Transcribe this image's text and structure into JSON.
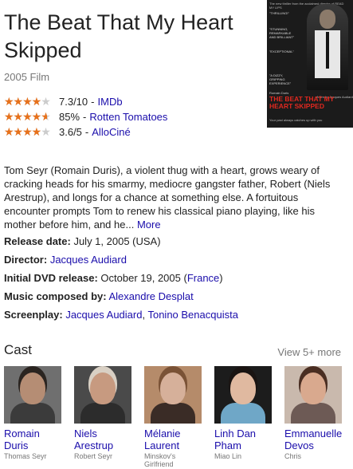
{
  "movie": {
    "title": "The Beat That My Heart Skipped",
    "subtitle": "2005 Film"
  },
  "poster": {
    "header": "The new thriller from the acclaimed director of READ MY LIPS",
    "quotes": [
      "\"THRILLING!\"",
      "\"STUNNING, REMARKABLE AND BRILLIANT\"",
      "\"EXCEPTIONAL\"",
      "\"A DIZZY, GRIPPING EXPERIENCE\""
    ],
    "director_name": "Romain Duris",
    "credit": "A film by Jacques Audiard",
    "title": "THE BEAT THAT MY HEART SKIPPED",
    "tagline": "Your past always catches up with you"
  },
  "ratings": [
    {
      "score": "7.3/10",
      "source": "IMDb",
      "stars_fraction": 0.73
    },
    {
      "score": "85%",
      "source": "Rotten Tomatoes",
      "stars_fraction": 0.85
    },
    {
      "score": "3.6/5",
      "source": "AlloCiné",
      "stars_fraction": 0.72
    }
  ],
  "rating_separator": "-",
  "description": {
    "text": "Tom Seyr (Romain Duris), a violent thug with a heart, grows weary of cracking heads for his smarmy, mediocre gangster father, Robert (Niels Arestrup), and longs for a chance at something else. A fortuitous encounter prompts Tom to renew his classical piano playing, like his mother before him, and he...",
    "more_label": "More"
  },
  "facts": {
    "release": {
      "label": "Release date:",
      "value": "July 1, 2005 (USA)"
    },
    "director": {
      "label": "Director:",
      "value": "Jacques Audiard"
    },
    "dvd": {
      "label": "Initial DVD release:",
      "value": "October 19, 2005 (",
      "link": "France",
      "after": ")"
    },
    "music": {
      "label": "Music composed by:",
      "value": "Alexandre Desplat"
    },
    "screenplay": {
      "label": "Screenplay:",
      "value1": "Jacques Audiard",
      "comma": ",",
      "value2": "Tonino Benacquista"
    }
  },
  "cast": {
    "title": "Cast",
    "view_more": "View 5+ more",
    "members": [
      {
        "name": "Romain Duris",
        "role": "Thomas Seyr",
        "skin": "#b58d74",
        "hair": "#2a2420",
        "cloth": "#3b3b3b",
        "bg": "#6f6f6f"
      },
      {
        "name": "Niels Arestrup",
        "role": "Robert Seyr",
        "skin": "#c79a80",
        "hair": "#d9d0c4",
        "cloth": "#2c2c2c",
        "bg": "#4a4a4a"
      },
      {
        "name": "Mélanie Laurent",
        "role": "Minskov's Girlfriend",
        "skin": "#d6b09a",
        "hair": "#7a5236",
        "cloth": "#3a2c26",
        "bg": "#b58b6a"
      },
      {
        "name": "Linh Dan Pham",
        "role": "Miao Lin",
        "skin": "#e0b9a0",
        "hair": "#1a1412",
        "cloth": "#6fa7c7",
        "bg": "#1c1c1c"
      },
      {
        "name": "Emmanuelle Devos",
        "role": "Chris",
        "skin": "#d9a98e",
        "hair": "#4a2e22",
        "cloth": "#6d5a55",
        "bg": "#c9b9ad"
      }
    ]
  },
  "colors": {
    "star": "#e7711b",
    "link": "#1a0dab",
    "muted": "#777777"
  }
}
